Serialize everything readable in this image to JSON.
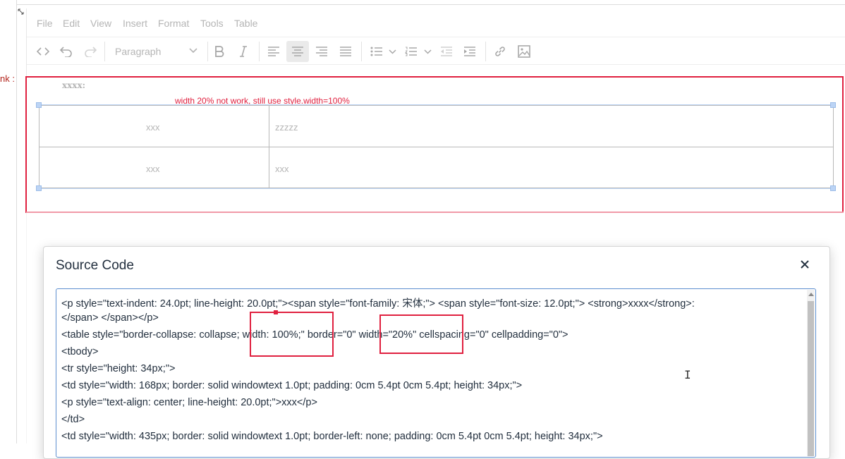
{
  "page": {
    "side_text": "nk :",
    "corner_icon": "resize-corner-icon"
  },
  "menubar": {
    "items": [
      "File",
      "Edit",
      "View",
      "Insert",
      "Format",
      "Tools",
      "Table"
    ]
  },
  "toolbar": {
    "format_value": "Paragraph",
    "icons": [
      "code-icon",
      "undo-icon",
      "redo-icon",
      "bold-icon",
      "italic-icon",
      "align-left-icon",
      "align-center-icon",
      "align-right-icon",
      "align-justify-icon",
      "bullet-list-icon",
      "numbered-list-icon",
      "outdent-icon",
      "indent-icon",
      "link-icon",
      "image-icon"
    ]
  },
  "document": {
    "paragraph": "xxxx:",
    "annotation": "width 20% not work, still use style.width=100%",
    "table": {
      "rows": [
        [
          "xxx",
          "zzzzz"
        ],
        [
          "xxx",
          "xxx"
        ]
      ]
    }
  },
  "dialog": {
    "title": "Source Code",
    "close_label": "✕",
    "code_lines": [
      "<p style=\"text-indent: 24.0pt; line-height: 20.0pt;\"><span style=\"font-family: 宋体;\"> <span style=\"font-size: 12.0pt;\"> <strong>xxxx</strong>:",
      "</span> </span></p>",
      "<table style=\"border-collapse: collapse; width: 100%;\" border=\"0\" width=\"20%\" cellspacing=\"0\" cellpadding=\"0\">",
      "<tbody>",
      "<tr style=\"height: 34px;\">",
      "<td style=\"width: 168px; border: solid windowtext 1.0pt; padding: 0cm 5.4pt 0cm 5.4pt; height: 34px;\">",
      "<p style=\"text-align: center; line-height: 20.0pt;\">xxx</p>",
      "</td>",
      "<td style=\"width: 435px; border: solid windowtext 1.0pt; border-left: none; padding: 0cm 5.4pt 0cm 5.4pt; height: 34px;\">"
    ]
  },
  "colors": {
    "annotation_red": "#e0203f",
    "selection_blue": "#bcd4f5",
    "text_dark": "#222f3e",
    "disabled_grey": "#b5b5b5"
  }
}
